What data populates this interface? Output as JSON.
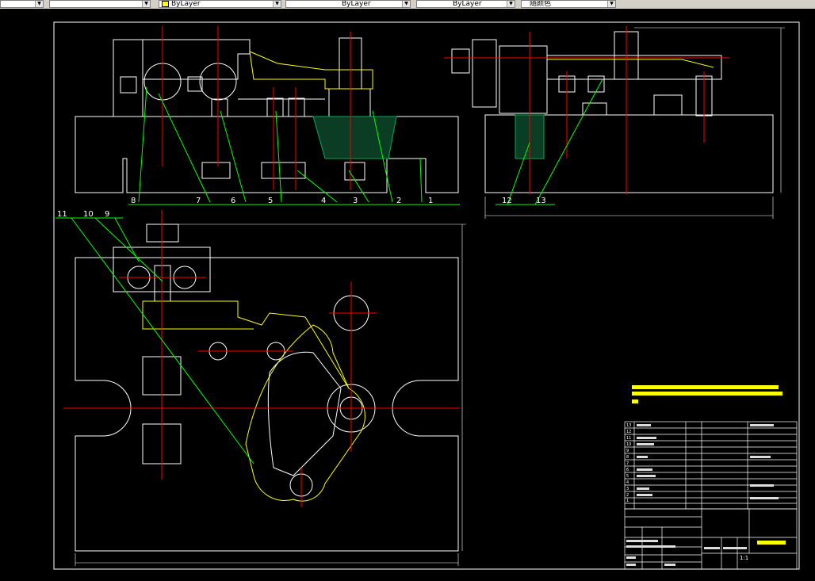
{
  "toolbar": {
    "items": [
      {
        "text": "",
        "selected": false
      },
      {
        "text": "ByLayer",
        "selected": false
      },
      {
        "text": "ByLayer",
        "selected": false
      },
      {
        "text": "ByLayer",
        "selected": false
      },
      {
        "text": "随颜色",
        "selected": false
      }
    ]
  },
  "colors": {
    "background": "#000000",
    "outline": "#ffffff",
    "center": "#ff0000",
    "leader": "#00ff00",
    "yellow": "#ffff00",
    "section": "#00aa55"
  },
  "balloons_top": [
    "8",
    "7",
    "6",
    "5",
    "4",
    "3",
    "2",
    "1"
  ],
  "balloons_side": [
    "12",
    "13"
  ],
  "balloons_plan": [
    "11",
    "10",
    "9"
  ],
  "title_block": {
    "scale": "1:1",
    "rows": [
      "13",
      "12",
      "11",
      "10",
      "9",
      "8",
      "7",
      "6",
      "5",
      "4",
      "3",
      "2",
      "1"
    ]
  }
}
